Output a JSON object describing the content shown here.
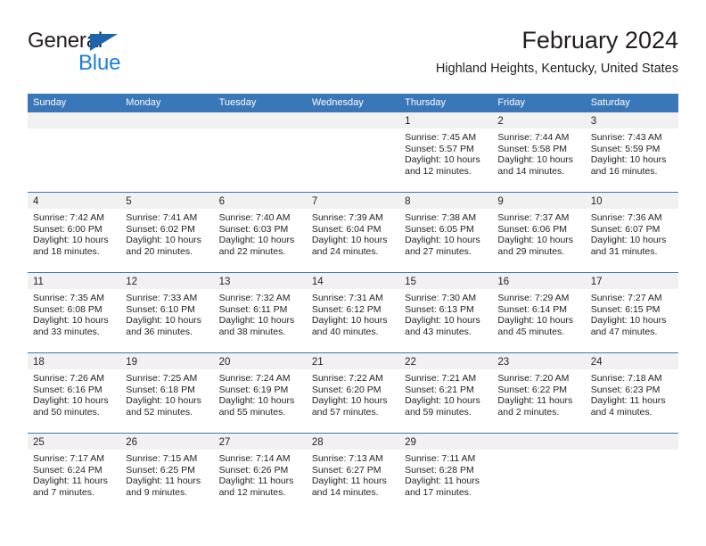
{
  "brand": {
    "name_top": "General",
    "name_bottom": "Blue",
    "triangle_icon": "triangle-icon",
    "color_black": "#231f20",
    "color_blue": "#1d7fd4"
  },
  "header": {
    "title": "February 2024",
    "subtitle": "Highland Heights, Kentucky, United States"
  },
  "theme": {
    "header_blue": "#3a77b9",
    "day_band_gray": "#f1f1f1",
    "text": "#231f20"
  },
  "weekdays": [
    "Sunday",
    "Monday",
    "Tuesday",
    "Wednesday",
    "Thursday",
    "Friday",
    "Saturday"
  ],
  "labels": {
    "sunrise": "Sunrise:",
    "sunset": "Sunset:",
    "daylight": "Daylight:"
  },
  "weeks": [
    [
      {
        "day": "",
        "sunrise": "",
        "sunset": "",
        "daylight_1": "",
        "daylight_2": ""
      },
      {
        "day": "",
        "sunrise": "",
        "sunset": "",
        "daylight_1": "",
        "daylight_2": ""
      },
      {
        "day": "",
        "sunrise": "",
        "sunset": "",
        "daylight_1": "",
        "daylight_2": ""
      },
      {
        "day": "",
        "sunrise": "",
        "sunset": "",
        "daylight_1": "",
        "daylight_2": ""
      },
      {
        "day": "1",
        "sunrise": "Sunrise: 7:45 AM",
        "sunset": "Sunset: 5:57 PM",
        "daylight_1": "Daylight: 10 hours",
        "daylight_2": "and 12 minutes."
      },
      {
        "day": "2",
        "sunrise": "Sunrise: 7:44 AM",
        "sunset": "Sunset: 5:58 PM",
        "daylight_1": "Daylight: 10 hours",
        "daylight_2": "and 14 minutes."
      },
      {
        "day": "3",
        "sunrise": "Sunrise: 7:43 AM",
        "sunset": "Sunset: 5:59 PM",
        "daylight_1": "Daylight: 10 hours",
        "daylight_2": "and 16 minutes."
      }
    ],
    [
      {
        "day": "4",
        "sunrise": "Sunrise: 7:42 AM",
        "sunset": "Sunset: 6:00 PM",
        "daylight_1": "Daylight: 10 hours",
        "daylight_2": "and 18 minutes."
      },
      {
        "day": "5",
        "sunrise": "Sunrise: 7:41 AM",
        "sunset": "Sunset: 6:02 PM",
        "daylight_1": "Daylight: 10 hours",
        "daylight_2": "and 20 minutes."
      },
      {
        "day": "6",
        "sunrise": "Sunrise: 7:40 AM",
        "sunset": "Sunset: 6:03 PM",
        "daylight_1": "Daylight: 10 hours",
        "daylight_2": "and 22 minutes."
      },
      {
        "day": "7",
        "sunrise": "Sunrise: 7:39 AM",
        "sunset": "Sunset: 6:04 PM",
        "daylight_1": "Daylight: 10 hours",
        "daylight_2": "and 24 minutes."
      },
      {
        "day": "8",
        "sunrise": "Sunrise: 7:38 AM",
        "sunset": "Sunset: 6:05 PM",
        "daylight_1": "Daylight: 10 hours",
        "daylight_2": "and 27 minutes."
      },
      {
        "day": "9",
        "sunrise": "Sunrise: 7:37 AM",
        "sunset": "Sunset: 6:06 PM",
        "daylight_1": "Daylight: 10 hours",
        "daylight_2": "and 29 minutes."
      },
      {
        "day": "10",
        "sunrise": "Sunrise: 7:36 AM",
        "sunset": "Sunset: 6:07 PM",
        "daylight_1": "Daylight: 10 hours",
        "daylight_2": "and 31 minutes."
      }
    ],
    [
      {
        "day": "11",
        "sunrise": "Sunrise: 7:35 AM",
        "sunset": "Sunset: 6:08 PM",
        "daylight_1": "Daylight: 10 hours",
        "daylight_2": "and 33 minutes."
      },
      {
        "day": "12",
        "sunrise": "Sunrise: 7:33 AM",
        "sunset": "Sunset: 6:10 PM",
        "daylight_1": "Daylight: 10 hours",
        "daylight_2": "and 36 minutes."
      },
      {
        "day": "13",
        "sunrise": "Sunrise: 7:32 AM",
        "sunset": "Sunset: 6:11 PM",
        "daylight_1": "Daylight: 10 hours",
        "daylight_2": "and 38 minutes."
      },
      {
        "day": "14",
        "sunrise": "Sunrise: 7:31 AM",
        "sunset": "Sunset: 6:12 PM",
        "daylight_1": "Daylight: 10 hours",
        "daylight_2": "and 40 minutes."
      },
      {
        "day": "15",
        "sunrise": "Sunrise: 7:30 AM",
        "sunset": "Sunset: 6:13 PM",
        "daylight_1": "Daylight: 10 hours",
        "daylight_2": "and 43 minutes."
      },
      {
        "day": "16",
        "sunrise": "Sunrise: 7:29 AM",
        "sunset": "Sunset: 6:14 PM",
        "daylight_1": "Daylight: 10 hours",
        "daylight_2": "and 45 minutes."
      },
      {
        "day": "17",
        "sunrise": "Sunrise: 7:27 AM",
        "sunset": "Sunset: 6:15 PM",
        "daylight_1": "Daylight: 10 hours",
        "daylight_2": "and 47 minutes."
      }
    ],
    [
      {
        "day": "18",
        "sunrise": "Sunrise: 7:26 AM",
        "sunset": "Sunset: 6:16 PM",
        "daylight_1": "Daylight: 10 hours",
        "daylight_2": "and 50 minutes."
      },
      {
        "day": "19",
        "sunrise": "Sunrise: 7:25 AM",
        "sunset": "Sunset: 6:18 PM",
        "daylight_1": "Daylight: 10 hours",
        "daylight_2": "and 52 minutes."
      },
      {
        "day": "20",
        "sunrise": "Sunrise: 7:24 AM",
        "sunset": "Sunset: 6:19 PM",
        "daylight_1": "Daylight: 10 hours",
        "daylight_2": "and 55 minutes."
      },
      {
        "day": "21",
        "sunrise": "Sunrise: 7:22 AM",
        "sunset": "Sunset: 6:20 PM",
        "daylight_1": "Daylight: 10 hours",
        "daylight_2": "and 57 minutes."
      },
      {
        "day": "22",
        "sunrise": "Sunrise: 7:21 AM",
        "sunset": "Sunset: 6:21 PM",
        "daylight_1": "Daylight: 10 hours",
        "daylight_2": "and 59 minutes."
      },
      {
        "day": "23",
        "sunrise": "Sunrise: 7:20 AM",
        "sunset": "Sunset: 6:22 PM",
        "daylight_1": "Daylight: 11 hours",
        "daylight_2": "and 2 minutes."
      },
      {
        "day": "24",
        "sunrise": "Sunrise: 7:18 AM",
        "sunset": "Sunset: 6:23 PM",
        "daylight_1": "Daylight: 11 hours",
        "daylight_2": "and 4 minutes."
      }
    ],
    [
      {
        "day": "25",
        "sunrise": "Sunrise: 7:17 AM",
        "sunset": "Sunset: 6:24 PM",
        "daylight_1": "Daylight: 11 hours",
        "daylight_2": "and 7 minutes."
      },
      {
        "day": "26",
        "sunrise": "Sunrise: 7:15 AM",
        "sunset": "Sunset: 6:25 PM",
        "daylight_1": "Daylight: 11 hours",
        "daylight_2": "and 9 minutes."
      },
      {
        "day": "27",
        "sunrise": "Sunrise: 7:14 AM",
        "sunset": "Sunset: 6:26 PM",
        "daylight_1": "Daylight: 11 hours",
        "daylight_2": "and 12 minutes."
      },
      {
        "day": "28",
        "sunrise": "Sunrise: 7:13 AM",
        "sunset": "Sunset: 6:27 PM",
        "daylight_1": "Daylight: 11 hours",
        "daylight_2": "and 14 minutes."
      },
      {
        "day": "29",
        "sunrise": "Sunrise: 7:11 AM",
        "sunset": "Sunset: 6:28 PM",
        "daylight_1": "Daylight: 11 hours",
        "daylight_2": "and 17 minutes."
      },
      {
        "day": "",
        "sunrise": "",
        "sunset": "",
        "daylight_1": "",
        "daylight_2": ""
      },
      {
        "day": "",
        "sunrise": "",
        "sunset": "",
        "daylight_1": "",
        "daylight_2": ""
      }
    ]
  ]
}
